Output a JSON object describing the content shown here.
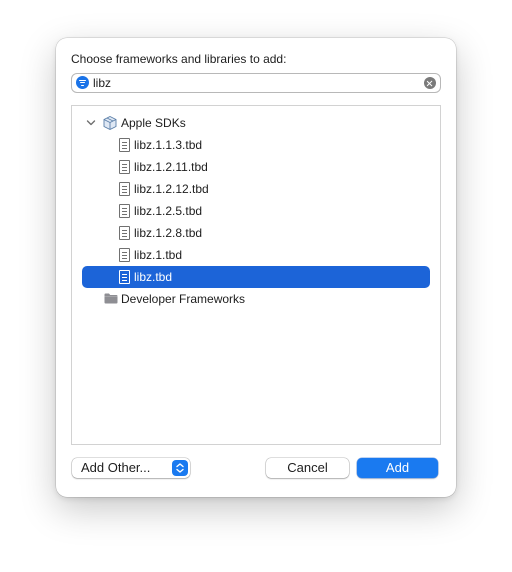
{
  "dialog": {
    "prompt": "Choose frameworks and libraries to add:"
  },
  "search": {
    "value": "libz",
    "icon": "filter-icon",
    "clear_icon": "clear-icon"
  },
  "tree": {
    "groups": [
      {
        "label": "Apple SDKs",
        "icon": "sdk-box-icon",
        "expanded": true
      },
      {
        "label": "Developer Frameworks",
        "icon": "folder-icon",
        "expanded": false
      }
    ],
    "items": [
      {
        "label": "libz.1.1.3.tbd",
        "selected": false
      },
      {
        "label": "libz.1.2.11.tbd",
        "selected": false
      },
      {
        "label": "libz.1.2.12.tbd",
        "selected": false
      },
      {
        "label": "libz.1.2.5.tbd",
        "selected": false
      },
      {
        "label": "libz.1.2.8.tbd",
        "selected": false
      },
      {
        "label": "libz.1.tbd",
        "selected": false
      },
      {
        "label": "libz.tbd",
        "selected": true
      }
    ]
  },
  "footer": {
    "add_other_label": "Add Other...",
    "cancel_label": "Cancel",
    "add_label": "Add"
  },
  "colors": {
    "accent": "#1a7af0",
    "selection": "#1c64d8"
  }
}
